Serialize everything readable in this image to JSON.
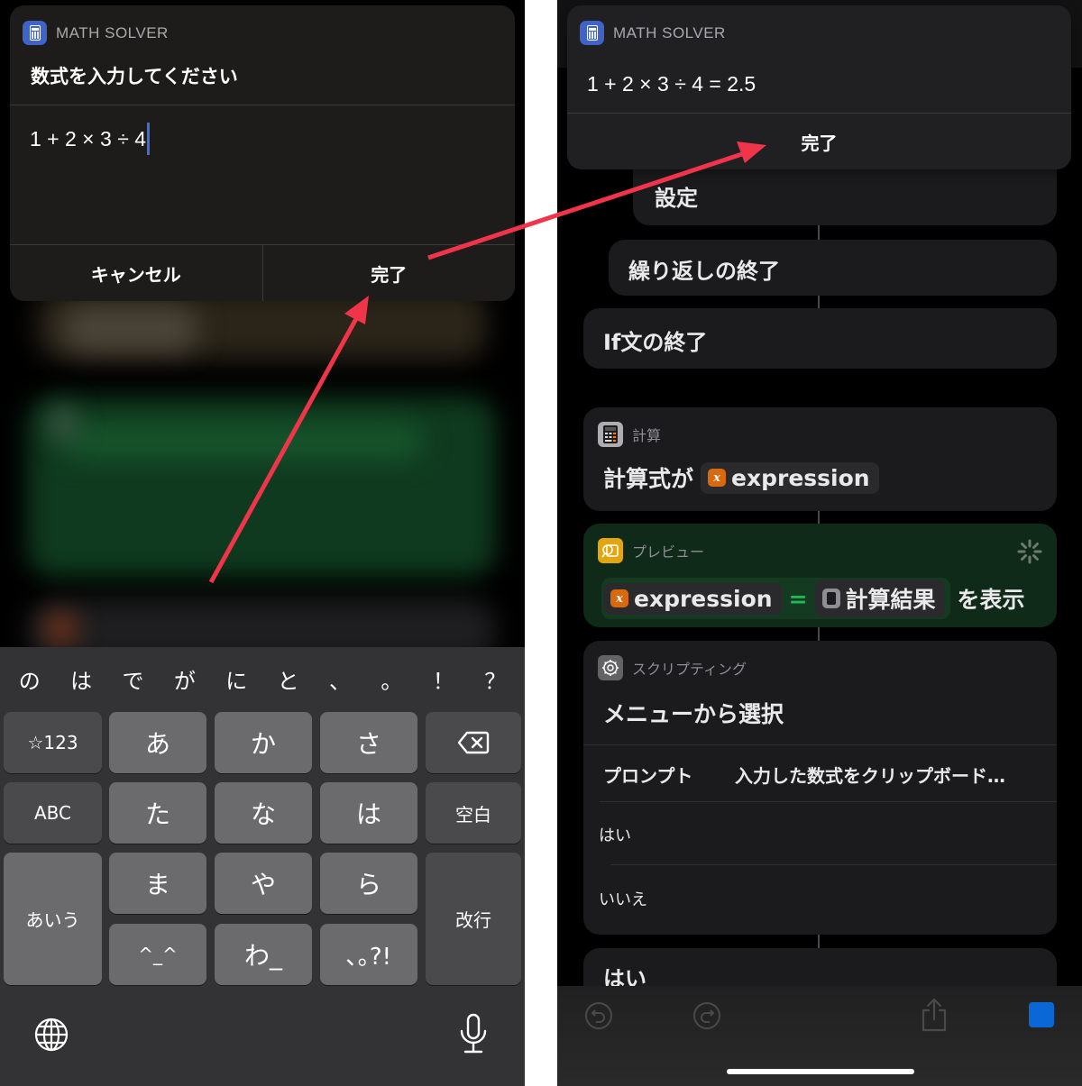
{
  "left": {
    "dialog": {
      "app_name": "MATH SOLVER",
      "app_icon": "calculator-icon",
      "prompt": "数式を入力してください",
      "input_value": "1 + 2 × 3 ÷ 4",
      "cancel_label": "キャンセル",
      "done_label": "完了"
    },
    "keyboard": {
      "predictions": [
        "の",
        "は",
        "で",
        "が",
        "に",
        "と",
        "、",
        "。",
        "！",
        "？"
      ],
      "keys": {
        "numbers": "☆123",
        "a": "あ",
        "ka": "か",
        "sa": "さ",
        "delete_icon": "backspace-icon",
        "abc": "ABC",
        "ta": "た",
        "na": "な",
        "ha": "は",
        "space": "空白",
        "kana": "あいう",
        "ma": "ま",
        "ya": "や",
        "ra": "ら",
        "return": "改行",
        "emoticon": "^_^",
        "wa": "わ_",
        "punct": "､｡?!"
      },
      "globe_icon": "globe-icon",
      "mic_icon": "microphone-icon"
    }
  },
  "right": {
    "result_dialog": {
      "app_name": "MATH SOLVER",
      "result_text": "1 + 2 × 3 ÷ 4 = 2.5",
      "done_label": "完了"
    },
    "actions": [
      {
        "title": "設定"
      },
      {
        "title": "繰り返しの終了"
      },
      {
        "title": "If文の終了"
      }
    ],
    "calculate": {
      "category": "計算",
      "prefix": "計算式が",
      "variable": "expression"
    },
    "preview": {
      "category": "プレビュー",
      "variable": "expression",
      "equals": "=",
      "result_var": "計算結果",
      "suffix": "を表示"
    },
    "scripting": {
      "category": "スクリプティング",
      "title": "メニューから選択",
      "prompt_label": "プロンプト",
      "prompt_value": "入力した数式をクリップボード…",
      "options": [
        "はい",
        "いいえ"
      ]
    },
    "next_block": {
      "title": "はい"
    },
    "toolbar": {
      "undo_icon": "undo-icon",
      "redo_icon": "redo-icon",
      "share_icon": "share-icon",
      "stop_icon": "stop-icon",
      "stop_color": "#0a67d6"
    }
  },
  "annotation": {
    "arrow_color": "#f0344a"
  }
}
